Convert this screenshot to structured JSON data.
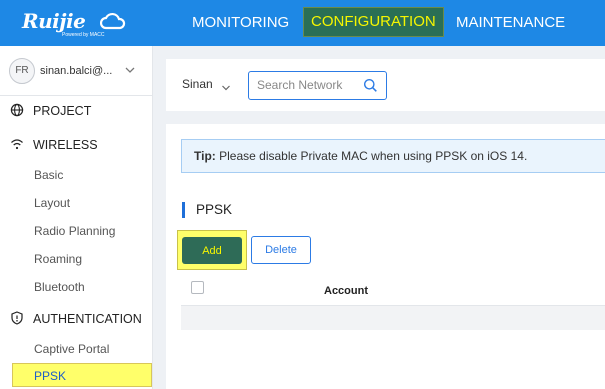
{
  "brand": {
    "logo_text": "Ruijie",
    "logo_sub": "Powered by MACC"
  },
  "top_nav": {
    "monitoring": "MONITORING",
    "configuration": "CONFIGURATION",
    "maintenance": "MAINTENANCE"
  },
  "user": {
    "avatar_initials": "FR",
    "name": "sinan.balci@..."
  },
  "sidebar": {
    "project": "PROJECT",
    "wireless": "WIRELESS",
    "wireless_items": [
      "Basic",
      "Layout",
      "Radio Planning",
      "Roaming",
      "Bluetooth"
    ],
    "authentication": "AUTHENTICATION",
    "auth_items": [
      "Captive Portal",
      "PPSK"
    ]
  },
  "filter": {
    "site": "Sinan",
    "search_placeholder": "Search Network"
  },
  "tip": {
    "label": "Tip:",
    "text": " Please disable Private MAC when using PPSK on iOS 14."
  },
  "section": {
    "title": "PPSK"
  },
  "buttons": {
    "add": "Add",
    "delete": "Delete"
  },
  "table": {
    "columns": [
      "Account"
    ]
  },
  "colors": {
    "header": "#1e88e5",
    "highlight": "#ffff6a",
    "add_button": "#2e6b57",
    "accent": "#2c7be5"
  }
}
